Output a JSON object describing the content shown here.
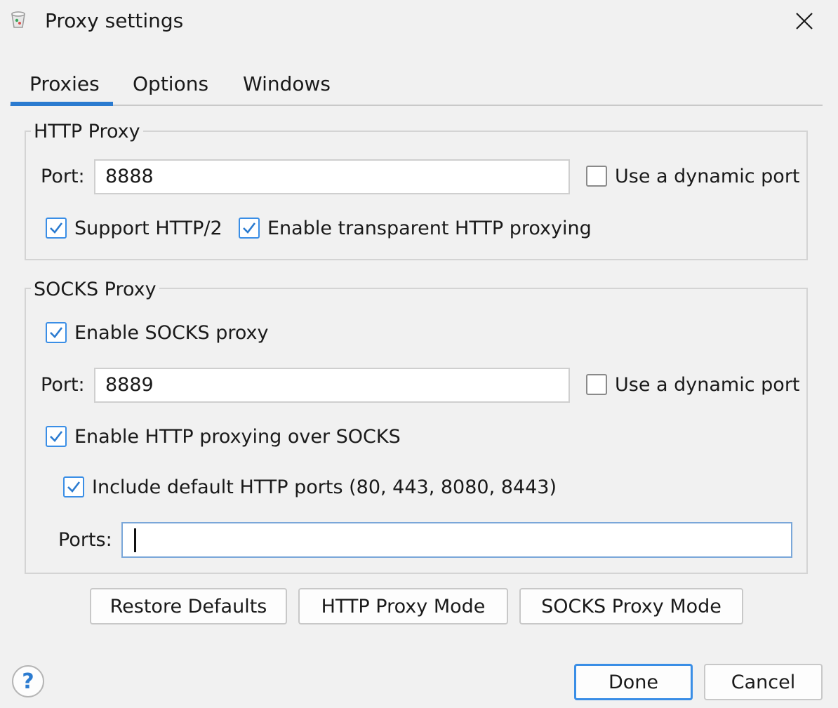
{
  "window": {
    "title": "Proxy settings",
    "icon": "app-icon",
    "close_icon": "close-icon"
  },
  "tabs": [
    {
      "label": "Proxies",
      "active": true
    },
    {
      "label": "Options",
      "active": false
    },
    {
      "label": "Windows",
      "active": false
    }
  ],
  "http_proxy": {
    "title": "HTTP Proxy",
    "port_label": "Port:",
    "port_value": "8888",
    "dynamic_port_label": "Use a dynamic port",
    "dynamic_port_checked": false,
    "http2_label": "Support HTTP/2",
    "http2_checked": true,
    "transparent_label": "Enable transparent HTTP proxying",
    "transparent_checked": true
  },
  "socks_proxy": {
    "title": "SOCKS Proxy",
    "enable_label": "Enable SOCKS proxy",
    "enable_checked": true,
    "port_label": "Port:",
    "port_value": "8889",
    "dynamic_port_label": "Use a dynamic port",
    "dynamic_port_checked": false,
    "http_over_socks_label": "Enable HTTP proxying over SOCKS",
    "http_over_socks_checked": true,
    "default_ports_label": "Include default HTTP ports (80, 443, 8080, 8443)",
    "default_ports_checked": true,
    "ports_label": "Ports:",
    "ports_value": ""
  },
  "mode_buttons": {
    "restore": "Restore Defaults",
    "http_mode": "HTTP Proxy Mode",
    "socks_mode": "SOCKS Proxy Mode"
  },
  "footer": {
    "help_icon": "help-icon",
    "help_glyph": "?",
    "done": "Done",
    "cancel": "Cancel"
  },
  "colors": {
    "accent": "#2b7bd0",
    "checkbox_blue": "#3a8ee6",
    "background": "#f1f1f1"
  }
}
